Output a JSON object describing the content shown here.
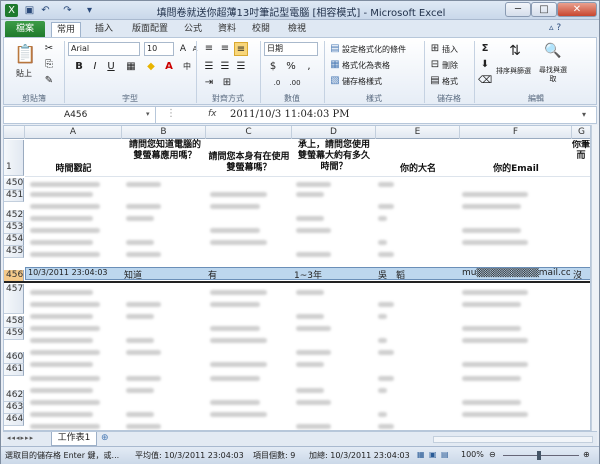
{
  "window": {
    "title": "填問卷就送你超薄13吋筆記型電腦 [相容模式] - Microsoft Excel",
    "min": "─",
    "max": "□",
    "close": "✕"
  },
  "qat": [
    "▣",
    "↶",
    "↷",
    "▾"
  ],
  "tabs": {
    "file": "檔案",
    "items": [
      "常用",
      "插入",
      "版面配置",
      "公式",
      "資料",
      "校閱",
      "檢視"
    ]
  },
  "ribbon": {
    "clipboard": {
      "label": "剪貼簿",
      "paste": "貼上"
    },
    "font": {
      "label": "字型",
      "name": "Arial",
      "size": "10",
      "bold": "B",
      "italic": "I",
      "underline": "U",
      "grow": "A",
      "shrink": "A"
    },
    "align": {
      "label": "對齊方式"
    },
    "number": {
      "label": "數值",
      "format": "日期",
      "currency": "$",
      "percent": "%",
      "comma": ","
    },
    "styles": {
      "label": "樣式",
      "cond": "設定格式化的條件",
      "table": "格式化為表格",
      "cell": "儲存格樣式"
    },
    "cells": {
      "label": "儲存格",
      "insert": "插入",
      "delete": "刪除",
      "format": "格式"
    },
    "editing": {
      "label": "編輯",
      "sum": "Σ",
      "sort": "排序與篩選",
      "find": "尋找與選取"
    }
  },
  "formula_bar": {
    "name_box": "A456",
    "fx": "fx",
    "value": "2011/10/3  11:04:03 PM"
  },
  "columns": [
    "A",
    "B",
    "C",
    "D",
    "E",
    "F",
    "G"
  ],
  "header_row": {
    "num": "1",
    "A": "時間戳記",
    "B": "請問您知道電腦的雙螢幕應用嗎？",
    "C": "請問您本身有在使用雙螢幕嗎？",
    "D": "承上，請問您使用雙螢幕大約有多久時間？",
    "E": "你的大名",
    "F": "你的Email",
    "G": "你筆而"
  },
  "row_numbers": [
    "450",
    "451",
    "452",
    "453",
    "454",
    "455",
    "456",
    "457",
    "458",
    "459",
    "460",
    "461",
    "462",
    "463",
    "464"
  ],
  "selected_row": {
    "num": "456",
    "A": "10/3/2011 23:04:03",
    "B": "知道",
    "C": "有",
    "D": "1~3年",
    "E": "吳　韜",
    "F": "mu▒▒▒▒▒▒▒▒▒mail.com",
    "G": "沒"
  },
  "sheet": {
    "tab": "工作表1",
    "nav": [
      "◂◂",
      "◂",
      "▸",
      "▸▸"
    ]
  },
  "status": {
    "mode": "選取目的儲存格 Enter 鍵，或...",
    "average": "平均值: 10/3/2011 23:04:03",
    "count": "項目個數: 9",
    "sum": "加總: 10/3/2011 23:04:03",
    "zoom": "100%"
  }
}
